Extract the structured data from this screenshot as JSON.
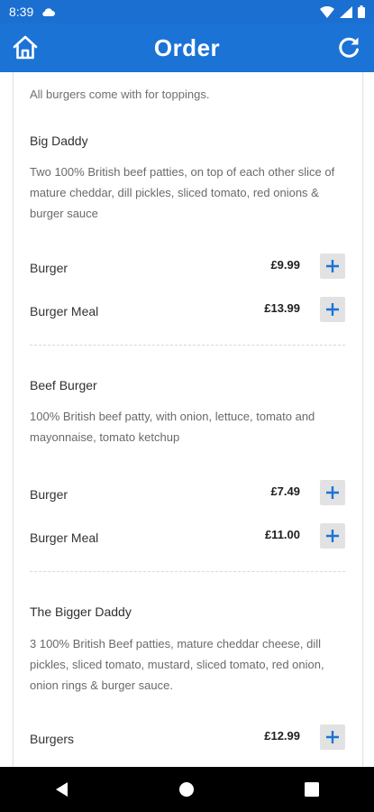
{
  "status_bar": {
    "time": "8:39",
    "icons": [
      "cloud-icon",
      "wifi-icon",
      "signal-icon",
      "battery-icon"
    ]
  },
  "app_bar": {
    "title": "Order",
    "left_icon": "home-icon",
    "right_icon": "refresh-icon"
  },
  "colors": {
    "primary": "#1b73d6",
    "add_button_bg": "#e2e2e2",
    "add_button_icon": "#1b73d6"
  },
  "menu": {
    "intro": "All burgers come with for toppings.",
    "items": [
      {
        "name": "Big Daddy",
        "description": "Two 100% British beef patties, on top of each other slice of mature cheddar, dill pickles, sliced tomato, red onions & burger sauce",
        "options": [
          {
            "label": "Burger",
            "price": "£9.99"
          },
          {
            "label": "Burger Meal",
            "price": "£13.99"
          }
        ]
      },
      {
        "name": "Beef Burger",
        "description": "100% British beef patty, with onion, lettuce, tomato and mayonnaise, tomato ketchup",
        "options": [
          {
            "label": "Burger",
            "price": "£7.49"
          },
          {
            "label": "Burger Meal",
            "price": "£11.00"
          }
        ]
      },
      {
        "name": "The Bigger Daddy",
        "description": "3 100% British Beef patties, mature cheddar cheese, dill pickles, sliced tomato, mustard, sliced tomato, red onion, onion rings & burger sauce.",
        "options": [
          {
            "label": "Burgers",
            "price": "£12.99"
          }
        ]
      }
    ]
  },
  "nav_bar": {
    "icons": [
      "back-icon",
      "home-circle-icon",
      "recents-icon"
    ]
  }
}
